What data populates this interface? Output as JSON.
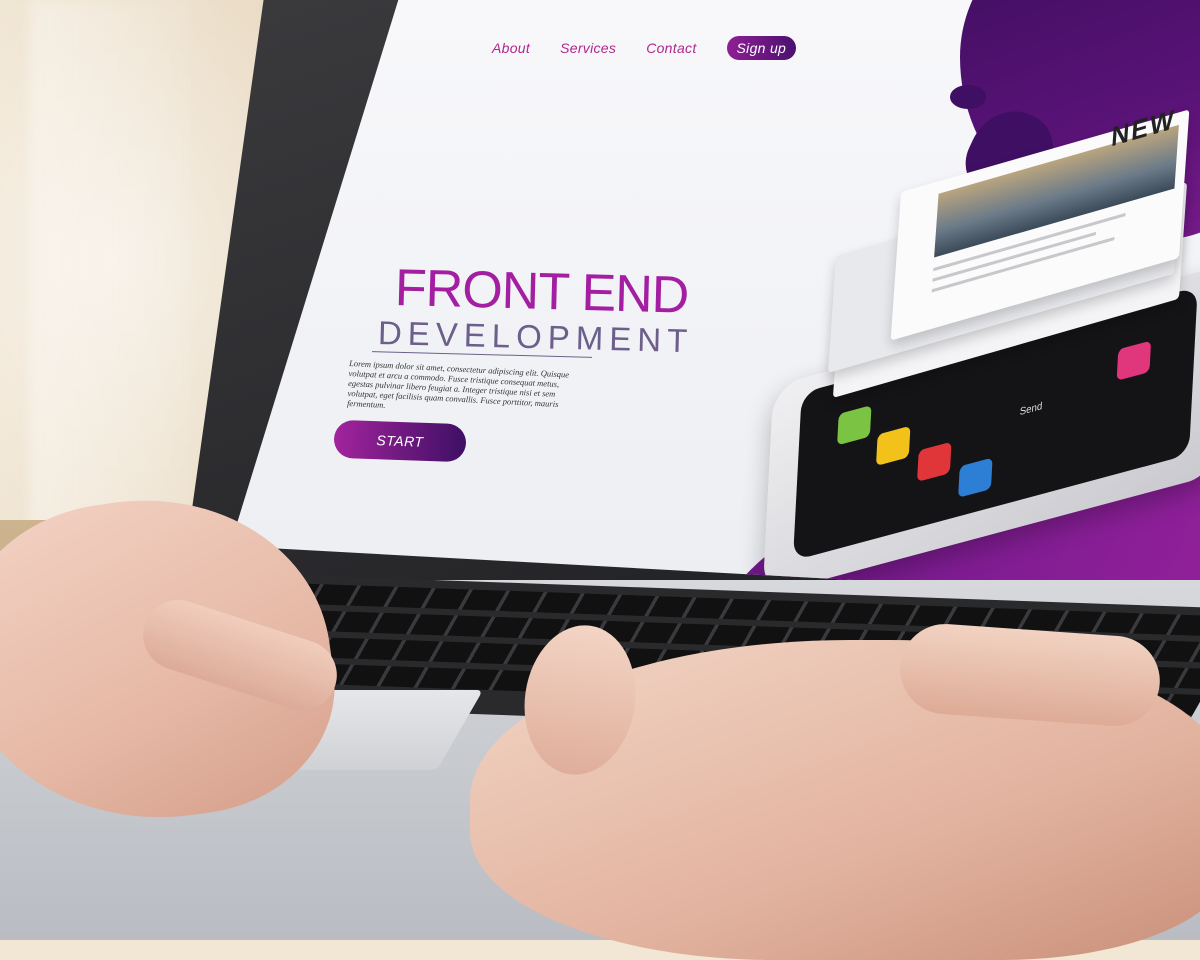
{
  "nav": {
    "items": [
      "About",
      "Services",
      "Contact"
    ],
    "signup_label": "Sign up"
  },
  "hero": {
    "title": "FRONT END",
    "subtitle": "DEVELOPMENT",
    "body": "Lorem ipsum dolor sit amet, consectetur adipiscing elit. Quisque volutpat et arcu a commodo. Fusce tristique consequat metus, egestas pulvinar libero feugiat a. Integer tristique nisi et sem volutpat, eget facilisis quam convallis. Fusce porttitor, mauris fermentum.",
    "button_label": "START"
  },
  "phone": {
    "news_heading": "NEW",
    "send_label": "Send"
  },
  "colors": {
    "accent_magenta": "#a41ea2",
    "accent_purple": "#3e0f64",
    "subtitle_gray_purple": "#6d5f8c"
  }
}
